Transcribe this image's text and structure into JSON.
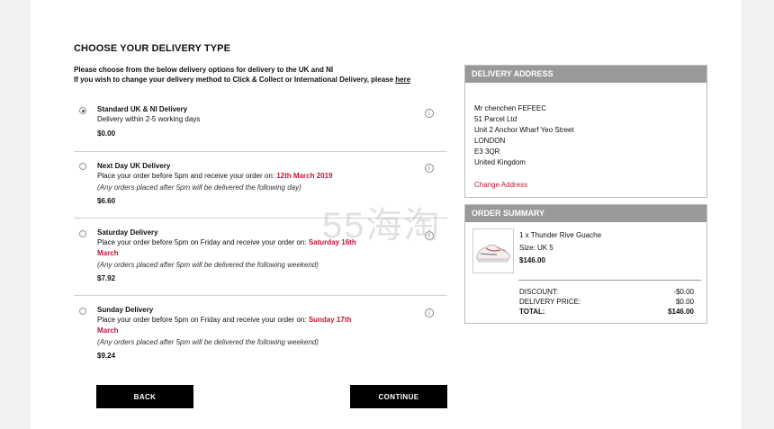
{
  "heading": "CHOOSE YOUR DELIVERY TYPE",
  "intro": {
    "line1": "Please choose from the below delivery options for delivery to the UK and NI",
    "line2": "If you wish to change your delivery method to Click & Collect or International Delivery, please",
    "link": "here"
  },
  "options": [
    {
      "title": "Standard UK & NI Delivery",
      "desc": "Delivery within 2-5 working days",
      "price": "$0.00",
      "selected": true
    },
    {
      "title": "Next Day UK Delivery",
      "desc": "Place your order before 5pm and receive your order on:",
      "date": "12th March 2019",
      "note": "(Any orders placed after 5pm will be delivered the following day)",
      "price": "$6.60",
      "selected": false
    },
    {
      "title": "Saturday Delivery",
      "desc": "Place your order before 5pm on Friday and receive your order on:",
      "date_a": "Saturday 16th",
      "date_b": "March",
      "note": "(Any orders placed after 5pm will be delivered the following weekend)",
      "price": "$7.92",
      "selected": false
    },
    {
      "title": "Sunday Delivery",
      "desc": "Place your order before 5pm on Friday and receive your order on:",
      "date_a": "Sunday 17th",
      "date_b": "March",
      "note": "(Any orders placed after 5pm will be delivered the following weekend)",
      "price": "$9.24",
      "selected": false
    }
  ],
  "buttons": {
    "back": "BACK",
    "continue": "CONTINUE"
  },
  "delivery_address": {
    "header": "DELIVERY ADDRESS",
    "lines": [
      "Mr chenchen FEFEEC",
      "51 Parcel Ltd",
      "Unit 2 Anchor Wharf Yeo Street",
      "LONDON",
      "E3 3QR",
      "United Kingdom"
    ],
    "change_link": "Change Address"
  },
  "order_summary": {
    "header": "ORDER SUMMARY",
    "item": {
      "name": "1 x Thunder Rive Guache",
      "size": "Size: UK 5",
      "price": "$146.00"
    },
    "discount_label": "DISCOUNT:",
    "discount": "-$0.00",
    "delivery_label": "DELIVERY PRICE:",
    "delivery": "$0.00",
    "total_label": "TOTAL:",
    "total": "$146.00"
  },
  "watermark": "55海淘",
  "colors": {
    "accent_red": "#c0163a",
    "panel_header": "#999999",
    "button": "#000000"
  },
  "icons": [
    "radio-selected-icon",
    "radio-icon",
    "info-icon",
    "sneaker-image"
  ]
}
